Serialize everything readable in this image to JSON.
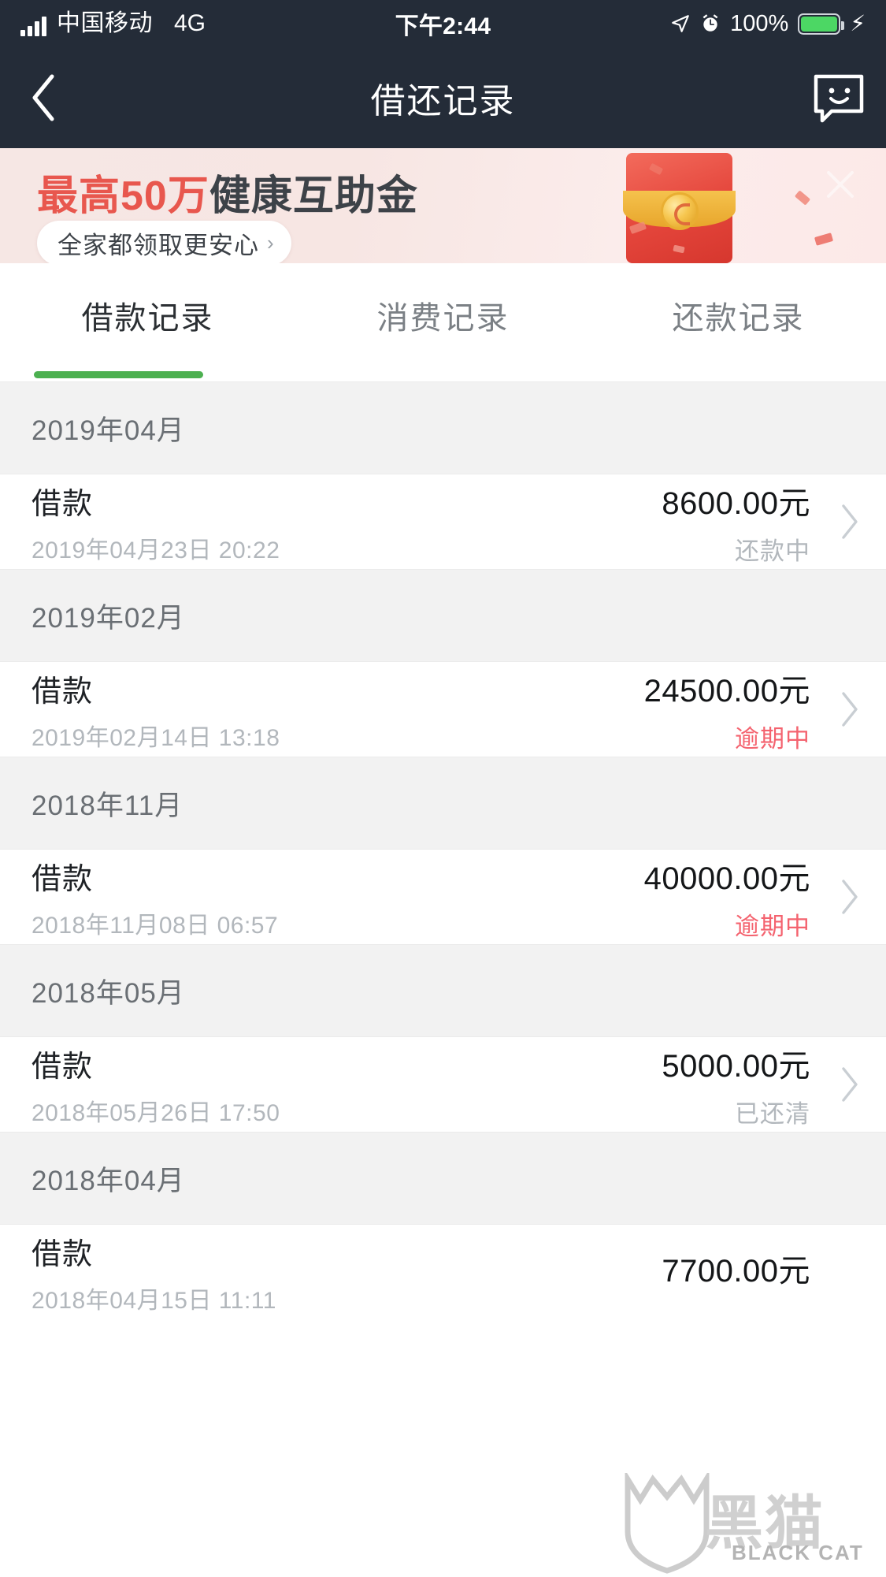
{
  "statusbar": {
    "carrier": "中国移动",
    "network": "4G",
    "time": "下午2:44",
    "battery": "100%",
    "signal_icon": "signal-bars-icon",
    "location_icon": "location-arrow-icon",
    "alarm_icon": "alarm-clock-icon",
    "battery_icon": "battery-full-icon",
    "charging_icon": "lightning-bolt-icon"
  },
  "navbar": {
    "back_icon": "chevron-left-icon",
    "title": "借还记录",
    "right_icon": "chat-smiley-icon"
  },
  "banner": {
    "headline_highlight": "最高50万",
    "headline_rest": "健康互助金",
    "cta_label": "全家都领取更安心",
    "cta_arrow": "›",
    "close_icon": "close-x-icon",
    "art_icon": "red-envelope-icon",
    "highlight_color": "#e8574e",
    "text_color": "#3d4248",
    "background_color": "#f7e7e4"
  },
  "tabs": {
    "items": [
      {
        "label": "借款记录",
        "active": true
      },
      {
        "label": "消费记录",
        "active": false
      },
      {
        "label": "还款记录",
        "active": false
      }
    ],
    "active_color": "#4cb050"
  },
  "list": {
    "sections": [
      {
        "month": "2019年04月",
        "rows": [
          {
            "type": "借款",
            "date": "2019年04月23日 20:22",
            "amount": "8600.00元",
            "status": "还款中",
            "status_kind": "normal"
          }
        ]
      },
      {
        "month": "2019年02月",
        "rows": [
          {
            "type": "借款",
            "date": "2019年02月14日 13:18",
            "amount": "24500.00元",
            "status": "逾期中",
            "status_kind": "overdue"
          }
        ]
      },
      {
        "month": "2018年11月",
        "rows": [
          {
            "type": "借款",
            "date": "2018年11月08日 06:57",
            "amount": "40000.00元",
            "status": "逾期中",
            "status_kind": "overdue"
          }
        ]
      },
      {
        "month": "2018年05月",
        "rows": [
          {
            "type": "借款",
            "date": "2018年05月26日 17:50",
            "amount": "5000.00元",
            "status": "已还清",
            "status_kind": "done"
          }
        ]
      },
      {
        "month": "2018年04月",
        "rows": [
          {
            "type": "借款",
            "date": "2018年04月15日 11:11",
            "amount": "7700.00元",
            "status": "",
            "status_kind": "normal"
          }
        ]
      }
    ],
    "chevron_icon": "chevron-right-icon",
    "overdue_color": "#f4636f",
    "muted_color": "#b2b7bc"
  },
  "watermark": {
    "brand": "黑猫",
    "brand_sub": "BLACK CAT",
    "icon": "cat-shield-icon"
  }
}
